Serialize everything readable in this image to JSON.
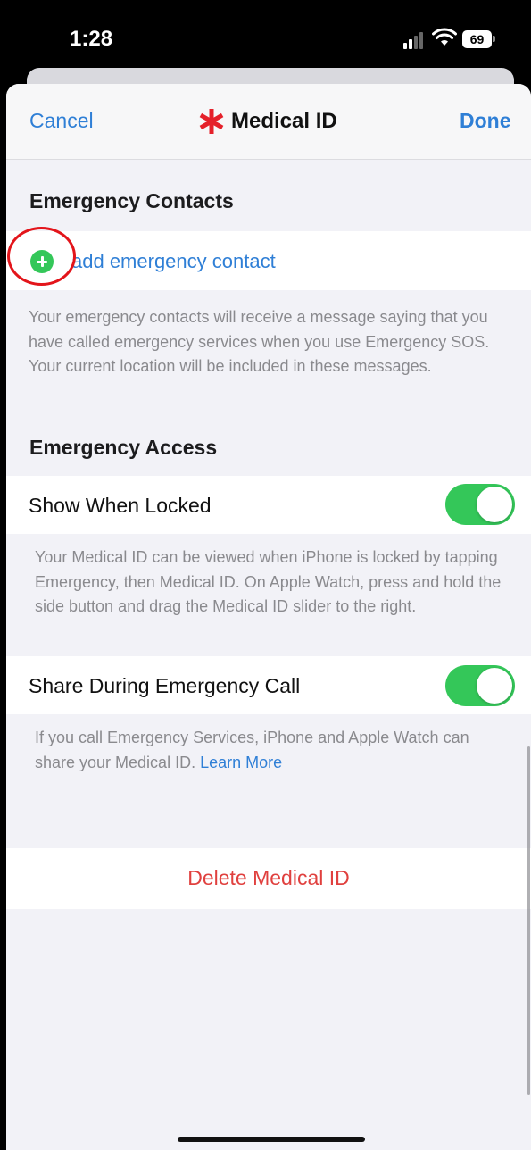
{
  "status_bar": {
    "time": "1:28",
    "battery": "69",
    "icons": [
      "signal-icon",
      "wifi-icon",
      "battery-icon"
    ]
  },
  "nav": {
    "cancel_label": "Cancel",
    "title": "Medical ID",
    "title_icon": "asterisk-icon",
    "done_label": "Done"
  },
  "emergency_contacts": {
    "header": "Emergency Contacts",
    "add_label": "add emergency contact",
    "footnote": "Your emergency contacts will receive a message saying that you have called emergency services when you use Emergency SOS. Your current location will be included in these messages."
  },
  "emergency_access": {
    "header": "Emergency Access",
    "show_when_locked": {
      "label": "Show When Locked",
      "enabled": true,
      "footnote": "Your Medical ID can be viewed when iPhone is locked by tapping Emergency, then Medical ID. On Apple Watch, press and hold the side button and drag the Medical ID slider to the right."
    },
    "share_during_call": {
      "label": "Share During Emergency Call",
      "enabled": true,
      "footnote": "If you call Emergency Services, iPhone and Apple Watch can share your Medical ID.",
      "learn_more_label": "Learn More"
    }
  },
  "delete_label": "Delete Medical ID",
  "colors": {
    "accent": "#2f7fd6",
    "toggle_on": "#34c759",
    "destructive": "#e0403e",
    "asterisk": "#e5202a",
    "highlight_circle": "#e3151b"
  }
}
